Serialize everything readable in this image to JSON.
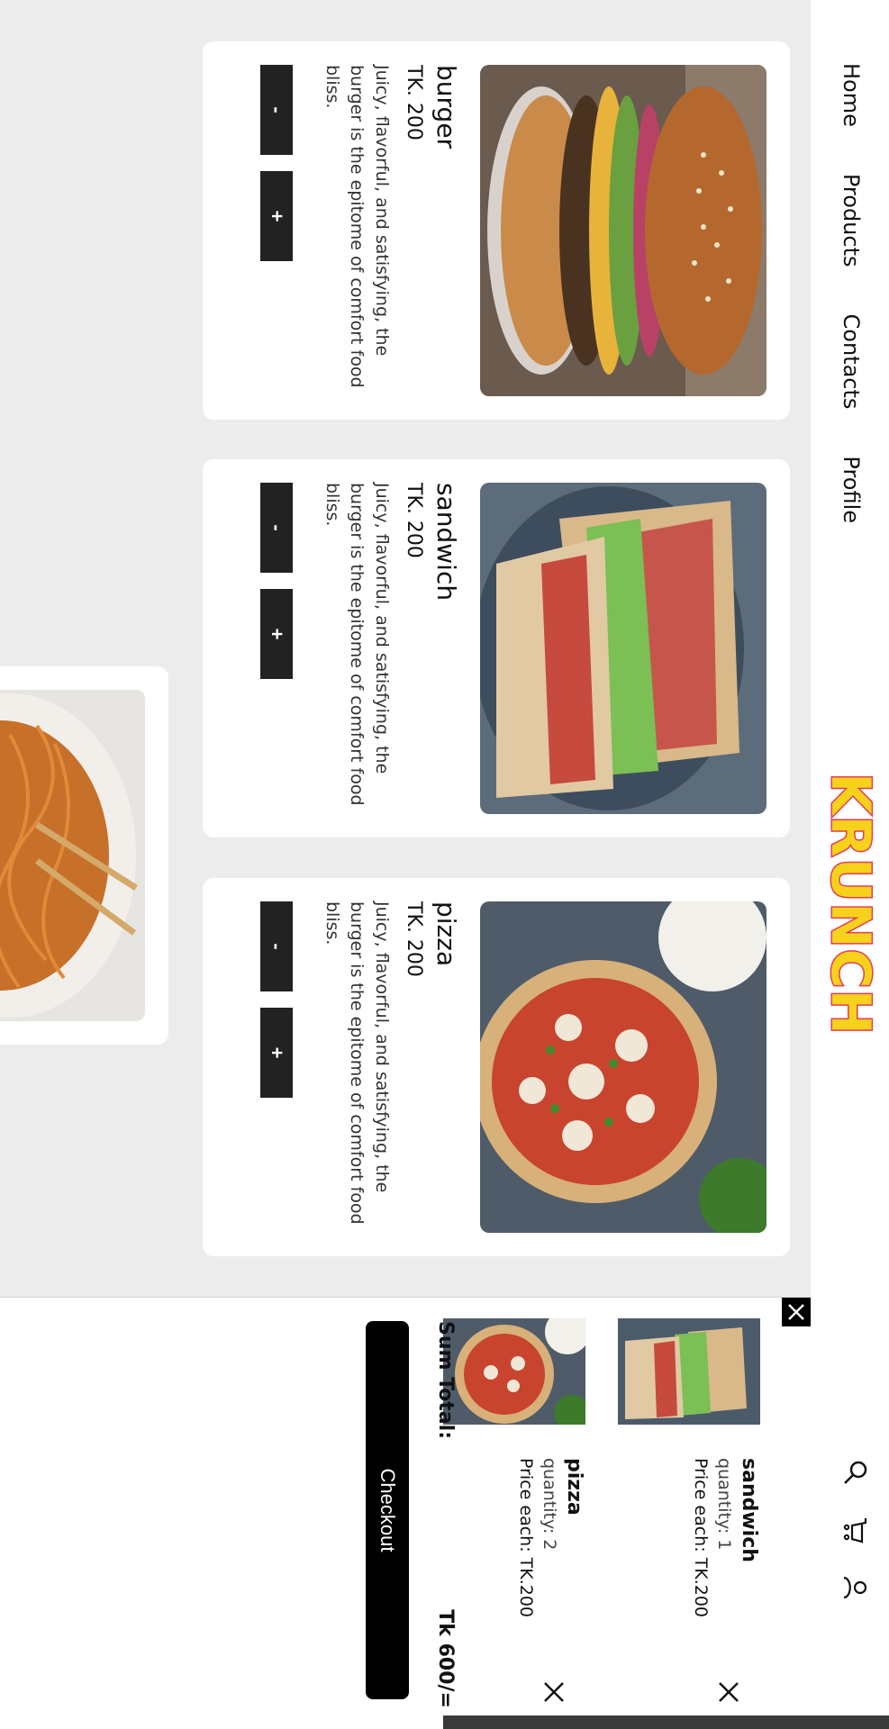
{
  "nav": {
    "links": [
      "Home",
      "Products",
      "Contacts",
      "Profile"
    ],
    "logo": "KRUNCH",
    "icons": [
      "search-icon",
      "cart-icon",
      "user-icon"
    ]
  },
  "products": [
    {
      "title": "burger",
      "price": "TK. 200",
      "description": "Juicy, flavorful, and satisfying, the burger is the epitome of comfort food bliss.",
      "minus": "-",
      "plus": "+"
    },
    {
      "title": "sandwich",
      "price": "TK. 200",
      "description": "Juicy, flavorful, and satisfying, the burger is the epitome of comfort food bliss.",
      "minus": "-",
      "plus": "+"
    },
    {
      "title": "pizza",
      "price": "TK. 200",
      "description": "Juicy, flavorful, and satisfying, the burger is the epitome of comfort food bliss.",
      "minus": "-",
      "plus": "+"
    }
  ],
  "cart": {
    "items": [
      {
        "name": "sandwich",
        "quantity": "quantity: 1",
        "price_each": "Price each: TK.200"
      },
      {
        "name": "pizza",
        "quantity": "quantity: 2",
        "price_each": "Price each: TK.200"
      }
    ],
    "sum_label": "Sum Total:",
    "sum_value": "Tk 600/=",
    "checkout_label": "Checkout"
  },
  "colors": {
    "logo_fill": "#f6d21b",
    "logo_stroke": "#e63a58",
    "button": "#222222",
    "background": "#ececec"
  }
}
